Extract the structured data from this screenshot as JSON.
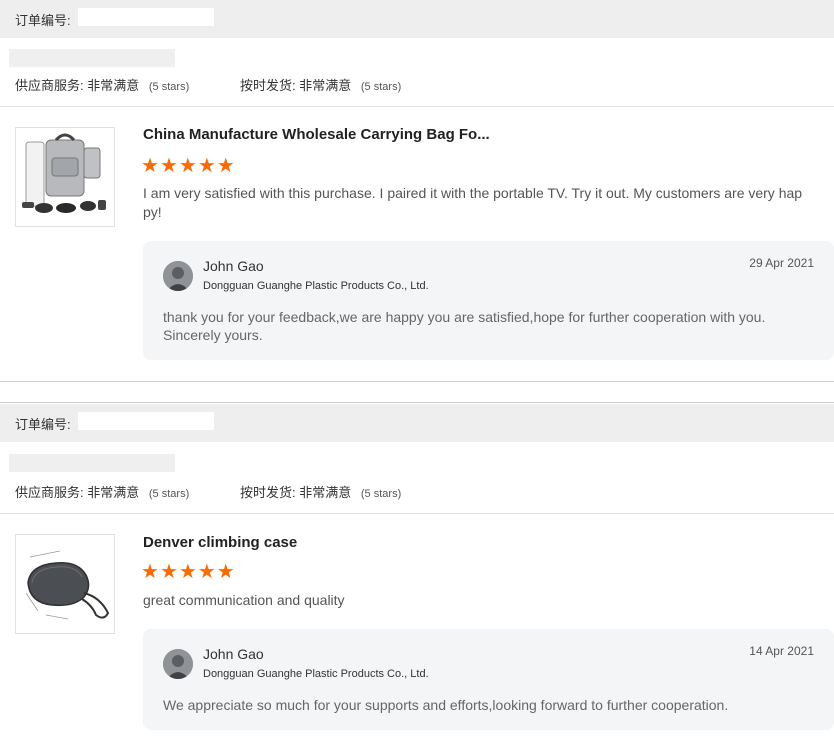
{
  "orders": [
    {
      "order_label": "订单编号:",
      "supplier_service_label": "供应商服务:",
      "supplier_service_value": "非常满意",
      "supplier_service_stars": "(5 stars)",
      "ontime_label": "按时发货:",
      "ontime_value": "非常满意",
      "ontime_stars": "(5 stars)",
      "product_title": "China Manufacture Wholesale Carrying Bag Fo...",
      "rating": 5,
      "review_text": "I am very satisfied with this purchase. I paired it with the portable TV. Try it out. My customers are very hap py!",
      "reply": {
        "name": "John Gao",
        "company": "Dongguan Guanghe Plastic Products Co., Ltd.",
        "date": "29 Apr 2021",
        "text": "thank you for your feedback,we are happy you are satisfied,hope for further cooperation with you. Sincerely yours."
      }
    },
    {
      "order_label": "订单编号:",
      "supplier_service_label": "供应商服务:",
      "supplier_service_value": "非常满意",
      "supplier_service_stars": "(5 stars)",
      "ontime_label": "按时发货:",
      "ontime_value": "非常满意",
      "ontime_stars": "(5 stars)",
      "product_title": "Denver climbing case",
      "rating": 5,
      "review_text": "great communication and quality",
      "reply": {
        "name": "John Gao",
        "company": "Dongguan Guanghe Plastic Products Co., Ltd.",
        "date": "14 Apr 2021",
        "text": "We appreciate so much for your supports and efforts,looking forward to further cooperation."
      }
    }
  ],
  "colors": {
    "star": "#ff6a00",
    "header_bg": "#eeeeee",
    "reply_bg": "#f4f5f7"
  },
  "icons": {
    "star": "star-icon",
    "avatar": "avatar"
  }
}
